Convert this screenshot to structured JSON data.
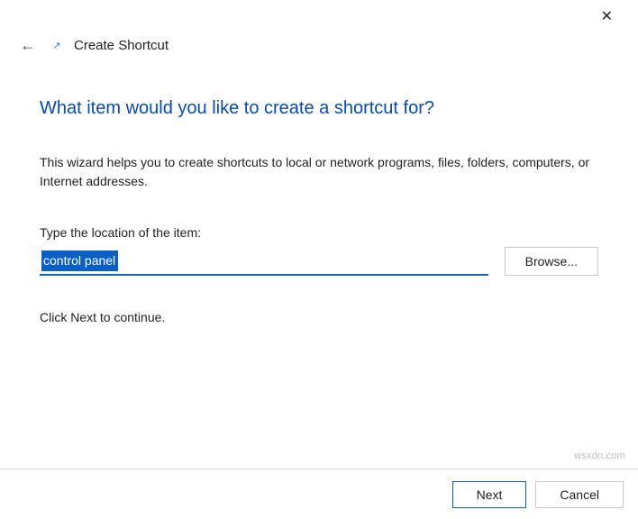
{
  "titlebar": {
    "close": "✕"
  },
  "header": {
    "back_arrow": "←",
    "icon": "↗",
    "title": "Create Shortcut"
  },
  "main": {
    "heading": "What item would you like to create a shortcut for?",
    "description": "This wizard helps you to create shortcuts to local or network programs, files, folders, computers, or Internet addresses.",
    "location_label": "Type the location of the item:",
    "location_value": "control panel",
    "browse_label": "Browse...",
    "continue_text": "Click Next to continue."
  },
  "footer": {
    "next_label": "Next",
    "cancel_label": "Cancel"
  },
  "watermark": "wsxdn.com"
}
